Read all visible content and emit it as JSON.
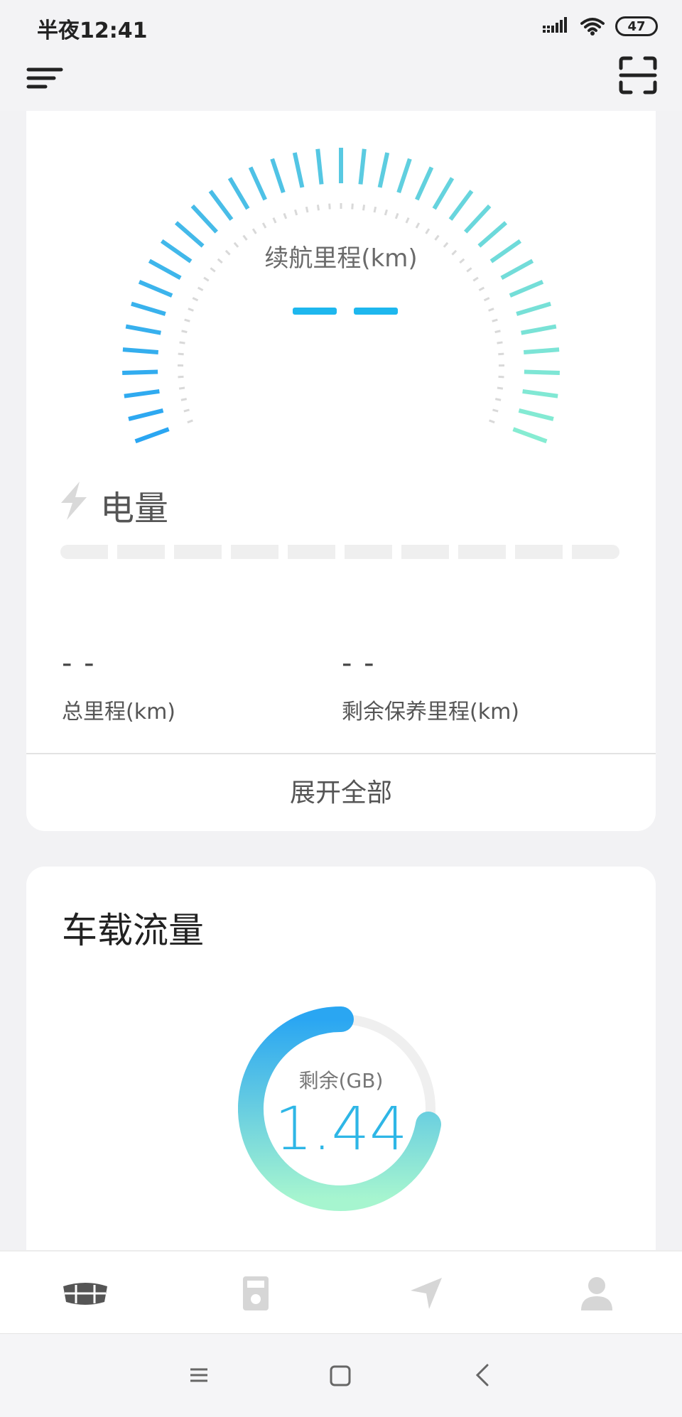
{
  "status_bar": {
    "time": "半夜12:41",
    "battery": "47"
  },
  "top_bar": {
    "menu_icon": "menu-icon",
    "scan_icon": "scan-icon"
  },
  "range_card": {
    "gauge_label": "续航里程(km)",
    "gauge_value": "- -",
    "battery_title": "电量",
    "battery_icon": "bolt-icon",
    "battery_segments": 10,
    "total_mileage_value": "- -",
    "total_mileage_label": "总里程(km)",
    "maintenance_value": "- -",
    "maintenance_label": "剩余保养里程(km)",
    "expand_label": "展开全部",
    "colors": {
      "accent_start": "#2aa6f2",
      "accent_end": "#86ecd2"
    }
  },
  "data_card": {
    "title": "车载流量",
    "remaining_label": "剩余(GB)",
    "remaining_value": "1.44",
    "colors": {
      "ring_start": "#2aa6f2",
      "ring_end": "#a6f5cf",
      "ring_track": "#efefef"
    }
  },
  "bottom_nav": {
    "items": [
      {
        "name": "car-logo-icon"
      },
      {
        "name": "remote-icon"
      },
      {
        "name": "navigation-icon"
      },
      {
        "name": "profile-icon"
      }
    ]
  },
  "system_nav": {
    "items": [
      "menu-icon",
      "home-icon",
      "back-icon"
    ]
  }
}
